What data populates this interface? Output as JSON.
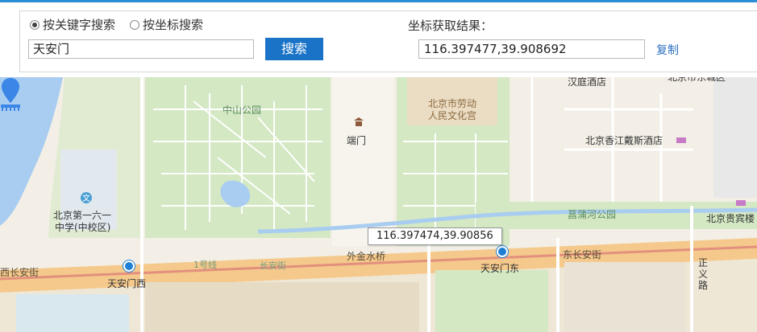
{
  "search_panel": {
    "options": [
      {
        "label": "按关键字搜索",
        "checked": true
      },
      {
        "label": "按坐标搜索",
        "checked": false
      }
    ],
    "keyword_value": "天安门",
    "search_button": "搜索",
    "result_label": "坐标获取结果：",
    "result_value": "116.397477,39.908692",
    "copy_link": "复制"
  },
  "map": {
    "marker_tooltip": "116.397474,39.90856",
    "labels": {
      "zhongshan_park": "中山公园",
      "workers_palace": "北京市劳动",
      "workers_palace_2": "人民文化宫",
      "duanmen": "端门",
      "hanting": "汉庭酒店",
      "top_right_partial": "北京市东城区",
      "shangri_la": "北京香江戴斯酒店",
      "changpu_park": "菖蒲河公园",
      "guibin": "北京贵宾楼",
      "school_1": "北京第一六一",
      "school_2": "中学(中校区)",
      "xichangan": "西长安街",
      "line1": "1号线",
      "changan": "长安街",
      "waijinshui": "外金水桥",
      "dongchangan": "东长安街",
      "tam_west": "天安门西",
      "tam_east": "天安门东",
      "zhengyi_1": "正",
      "zhengyi_2": "义",
      "zhengyi_3": "路"
    },
    "colors": {
      "land": "#f3efe6",
      "park": "#d3e8c3",
      "water": "#a9cdf0",
      "road_main": "#f5c98c",
      "road_red": "#e2907d",
      "accent": "#1a73c7"
    }
  }
}
